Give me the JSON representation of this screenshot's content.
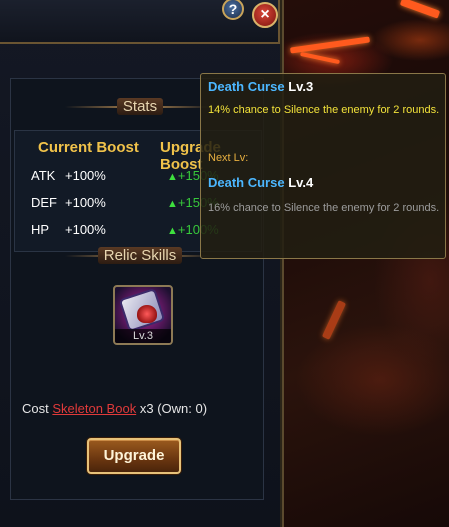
{
  "window": {
    "help_icon": "question-icon",
    "help_label": "?",
    "close_icon": "close-icon",
    "close_label": "×"
  },
  "stats": {
    "header": "Stats",
    "col_current": "Current Boost",
    "col_upgrade": "Upgrade Boost",
    "rows": [
      {
        "label": "ATK",
        "current": "+100%",
        "upgrade": "+150%"
      },
      {
        "label": "DEF",
        "current": "+100%",
        "upgrade": "+150%"
      },
      {
        "label": "HP",
        "current": "+100%",
        "upgrade": "+100%"
      }
    ]
  },
  "relic": {
    "header": "Relic Skills",
    "level": "Lv.3",
    "icon": "skull-book-icon"
  },
  "cost": {
    "label": "Cost",
    "item": "Skeleton Book",
    "qty": "x3",
    "own": "(Own: 0)"
  },
  "upgrade_button": "Upgrade",
  "tooltip": {
    "name": "Death Curse",
    "level": "Lv.3",
    "description": "14% chance to Silence the enemy for 2 rounds.",
    "next_label": "Next Lv:",
    "next_name": "Death Curse",
    "next_level": "Lv.4",
    "next_description": "16% chance to Silence the enemy for 2 rounds."
  },
  "colors": {
    "accent_gold": "#f0c24a",
    "skill_name": "#4cb7ff",
    "boost_green": "#37c83a",
    "cost_red": "#e03a3a"
  }
}
